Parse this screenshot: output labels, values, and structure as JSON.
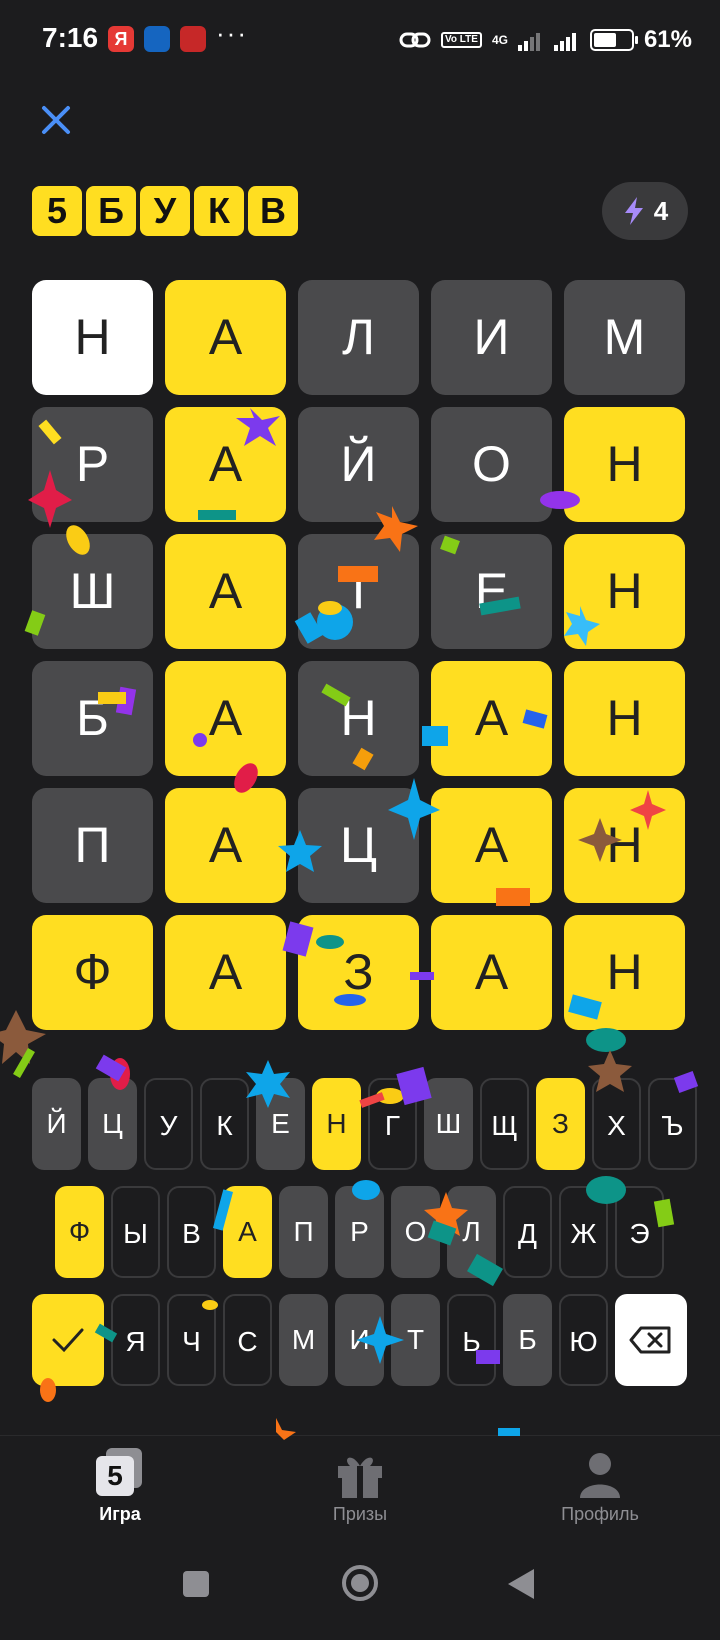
{
  "status_bar": {
    "time": "7:16",
    "notification_badge_1": "Я",
    "more": "···",
    "network": "4G",
    "volte": "Vo LTE",
    "battery_percent": "61%",
    "battery_level": 0.61
  },
  "header": {
    "logo_letters": [
      "5",
      "Б",
      "У",
      "К",
      "В"
    ],
    "hints_count": "4"
  },
  "grid": [
    [
      {
        "l": "Н",
        "s": "white"
      },
      {
        "l": "А",
        "s": "yellow"
      },
      {
        "l": "Л",
        "s": "gray"
      },
      {
        "l": "И",
        "s": "gray"
      },
      {
        "l": "М",
        "s": "gray"
      }
    ],
    [
      {
        "l": "Р",
        "s": "gray"
      },
      {
        "l": "А",
        "s": "yellow"
      },
      {
        "l": "Й",
        "s": "gray"
      },
      {
        "l": "О",
        "s": "gray"
      },
      {
        "l": "Н",
        "s": "yellow"
      }
    ],
    [
      {
        "l": "Ш",
        "s": "gray"
      },
      {
        "l": "А",
        "s": "yellow"
      },
      {
        "l": "Т",
        "s": "gray"
      },
      {
        "l": "Е",
        "s": "gray"
      },
      {
        "l": "Н",
        "s": "yellow"
      }
    ],
    [
      {
        "l": "Б",
        "s": "gray"
      },
      {
        "l": "А",
        "s": "yellow"
      },
      {
        "l": "Н",
        "s": "gray"
      },
      {
        "l": "А",
        "s": "yellow"
      },
      {
        "l": "Н",
        "s": "yellow"
      }
    ],
    [
      {
        "l": "П",
        "s": "gray"
      },
      {
        "l": "А",
        "s": "yellow"
      },
      {
        "l": "Ц",
        "s": "gray"
      },
      {
        "l": "А",
        "s": "yellow"
      },
      {
        "l": "Н",
        "s": "yellow"
      }
    ],
    [
      {
        "l": "Ф",
        "s": "yellow"
      },
      {
        "l": "А",
        "s": "yellow"
      },
      {
        "l": "З",
        "s": "yellow"
      },
      {
        "l": "А",
        "s": "yellow"
      },
      {
        "l": "Н",
        "s": "yellow"
      }
    ]
  ],
  "keyboard": {
    "row1": [
      {
        "k": "Й",
        "s": "gray"
      },
      {
        "k": "Ц",
        "s": "gray"
      },
      {
        "k": "У",
        "s": "default"
      },
      {
        "k": "К",
        "s": "default"
      },
      {
        "k": "Е",
        "s": "gray"
      },
      {
        "k": "Н",
        "s": "yellow"
      },
      {
        "k": "Г",
        "s": "default"
      },
      {
        "k": "Ш",
        "s": "gray"
      },
      {
        "k": "Щ",
        "s": "default"
      },
      {
        "k": "З",
        "s": "yellow"
      },
      {
        "k": "Х",
        "s": "default"
      },
      {
        "k": "Ъ",
        "s": "default"
      }
    ],
    "row2": [
      {
        "k": "Ф",
        "s": "yellow"
      },
      {
        "k": "Ы",
        "s": "default"
      },
      {
        "k": "В",
        "s": "default"
      },
      {
        "k": "А",
        "s": "yellow"
      },
      {
        "k": "П",
        "s": "gray"
      },
      {
        "k": "Р",
        "s": "gray"
      },
      {
        "k": "О",
        "s": "gray"
      },
      {
        "k": "Л",
        "s": "gray"
      },
      {
        "k": "Д",
        "s": "default"
      },
      {
        "k": "Ж",
        "s": "default"
      },
      {
        "k": "Э",
        "s": "default"
      }
    ],
    "row3": [
      {
        "k": "Я",
        "s": "default"
      },
      {
        "k": "Ч",
        "s": "default"
      },
      {
        "k": "С",
        "s": "default"
      },
      {
        "k": "М",
        "s": "gray"
      },
      {
        "k": "И",
        "s": "gray"
      },
      {
        "k": "Т",
        "s": "gray"
      },
      {
        "k": "Ь",
        "s": "default"
      },
      {
        "k": "Б",
        "s": "gray"
      },
      {
        "k": "Ю",
        "s": "default"
      }
    ]
  },
  "bottom_nav": {
    "game_icon_glyph": "5",
    "game": "Игра",
    "prizes": "Призы",
    "profile": "Профиль"
  },
  "colors": {
    "background": "#1c1c1e",
    "yellow": "#ffde21",
    "gray_tile": "#4a4a4c",
    "white_tile": "#ffffff",
    "close_icon": "#4a8ff7"
  }
}
